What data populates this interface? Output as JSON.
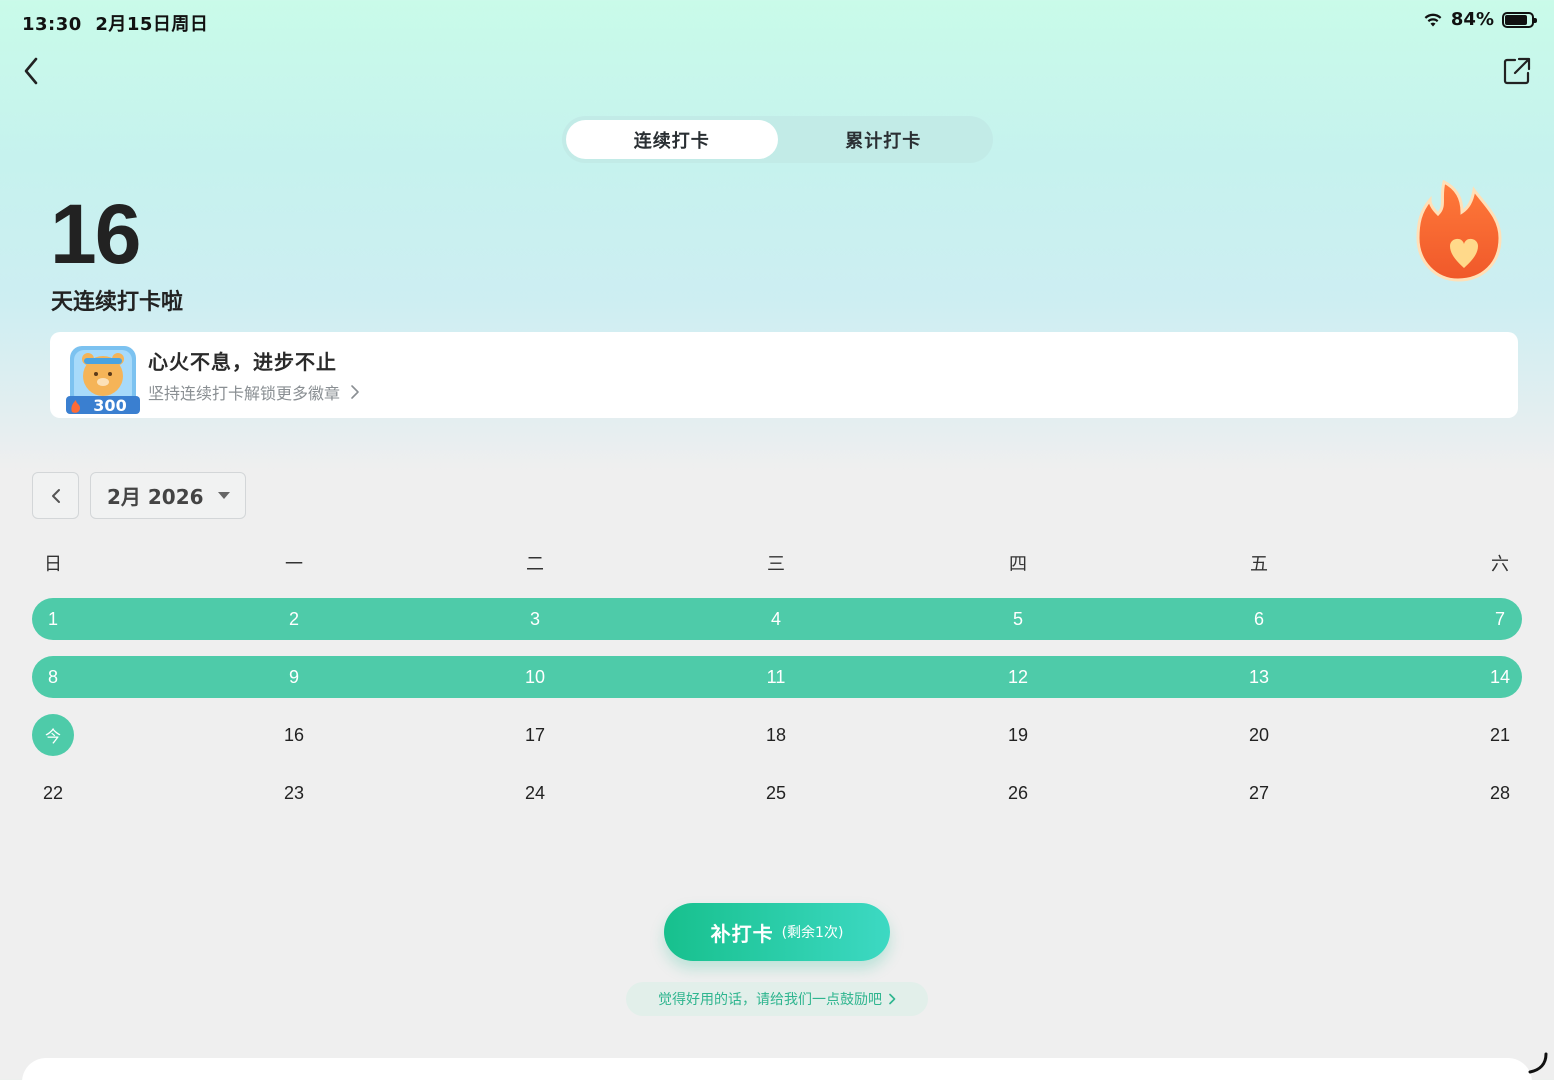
{
  "status_bar": {
    "time": "13:30",
    "date": "2月15日周日",
    "battery": "84%"
  },
  "nav": {
    "back_icon": "chevron-left-icon",
    "share_icon": "share-out-icon"
  },
  "tabs": [
    {
      "label": "连续打卡",
      "active": true
    },
    {
      "label": "累计打卡",
      "active": false
    }
  ],
  "streak": {
    "count": "16",
    "label": "天连续打卡啦"
  },
  "badge_card": {
    "title": "心火不息，进步不止",
    "subtitle": "坚持连续打卡解锁更多徽章",
    "badge_number": "300"
  },
  "calendar": {
    "month_label": "2月 2026",
    "weekdays": [
      "日",
      "一",
      "二",
      "三",
      "四",
      "五",
      "六"
    ],
    "weeks": [
      [
        "1",
        "2",
        "3",
        "4",
        "5",
        "6",
        "7"
      ],
      [
        "8",
        "9",
        "10",
        "11",
        "12",
        "13",
        "14"
      ],
      [
        "今",
        "16",
        "17",
        "18",
        "19",
        "20",
        "21"
      ],
      [
        "22",
        "23",
        "24",
        "25",
        "26",
        "27",
        "28"
      ]
    ],
    "checked_weeks": [
      0,
      1
    ],
    "today_label": "今",
    "accent": "#4ecba9"
  },
  "actions": {
    "makeup_label": "补打卡",
    "makeup_remaining": "(剩余1次)",
    "encourage_text": "觉得好用的话，请给我们一点鼓励吧"
  }
}
